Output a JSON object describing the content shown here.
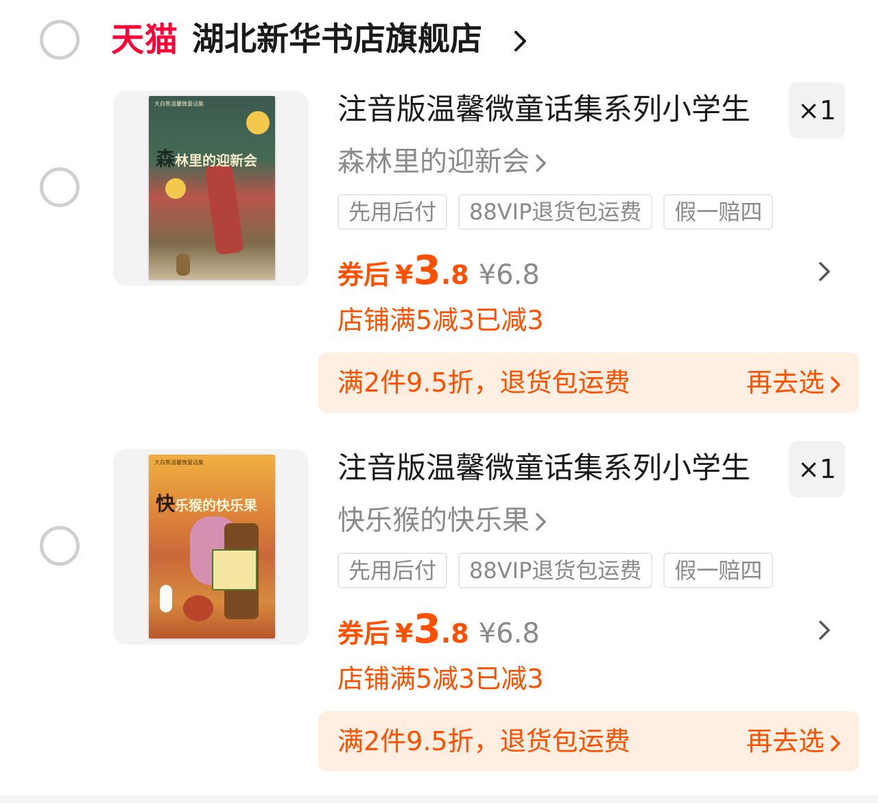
{
  "store": {
    "platform_logo": "天猫",
    "name": "湖北新华书店旗舰店"
  },
  "colors": {
    "accent": "#ff5000",
    "tmall_red": "#ff0036",
    "promo_bg": "#ffeee2"
  },
  "items": [
    {
      "title": "注音版温馨微童话集系列小学生",
      "subtitle": "森林里的迎新会",
      "quantity": "×1",
      "tags": [
        "先用后付",
        "88VIP退货包运费",
        "假一赔四"
      ],
      "coupon_label": "券后",
      "currency": "¥",
      "price_int": "3",
      "price_dec": ".8",
      "original_price": "¥6.8",
      "store_discount": "店铺满5减3已减3",
      "promo_text": "满2件9.5折，退货包运费",
      "promo_link": "再去选",
      "cover": {
        "title_big": "森",
        "title_rest": "林里的迎新会",
        "theme": "dark-green"
      }
    },
    {
      "title": "注音版温馨微童话集系列小学生",
      "subtitle": "快乐猴的快乐果",
      "quantity": "×1",
      "tags": [
        "先用后付",
        "88VIP退货包运费",
        "假一赔四"
      ],
      "coupon_label": "券后",
      "currency": "¥",
      "price_int": "3",
      "price_dec": ".8",
      "original_price": "¥6.8",
      "store_discount": "店铺满5减3已减3",
      "promo_text": "满2件9.5折，退货包运费",
      "promo_link": "再去选",
      "cover": {
        "title_big": "快",
        "title_rest": "乐猴的快乐果",
        "theme": "autumn-orange"
      }
    }
  ]
}
